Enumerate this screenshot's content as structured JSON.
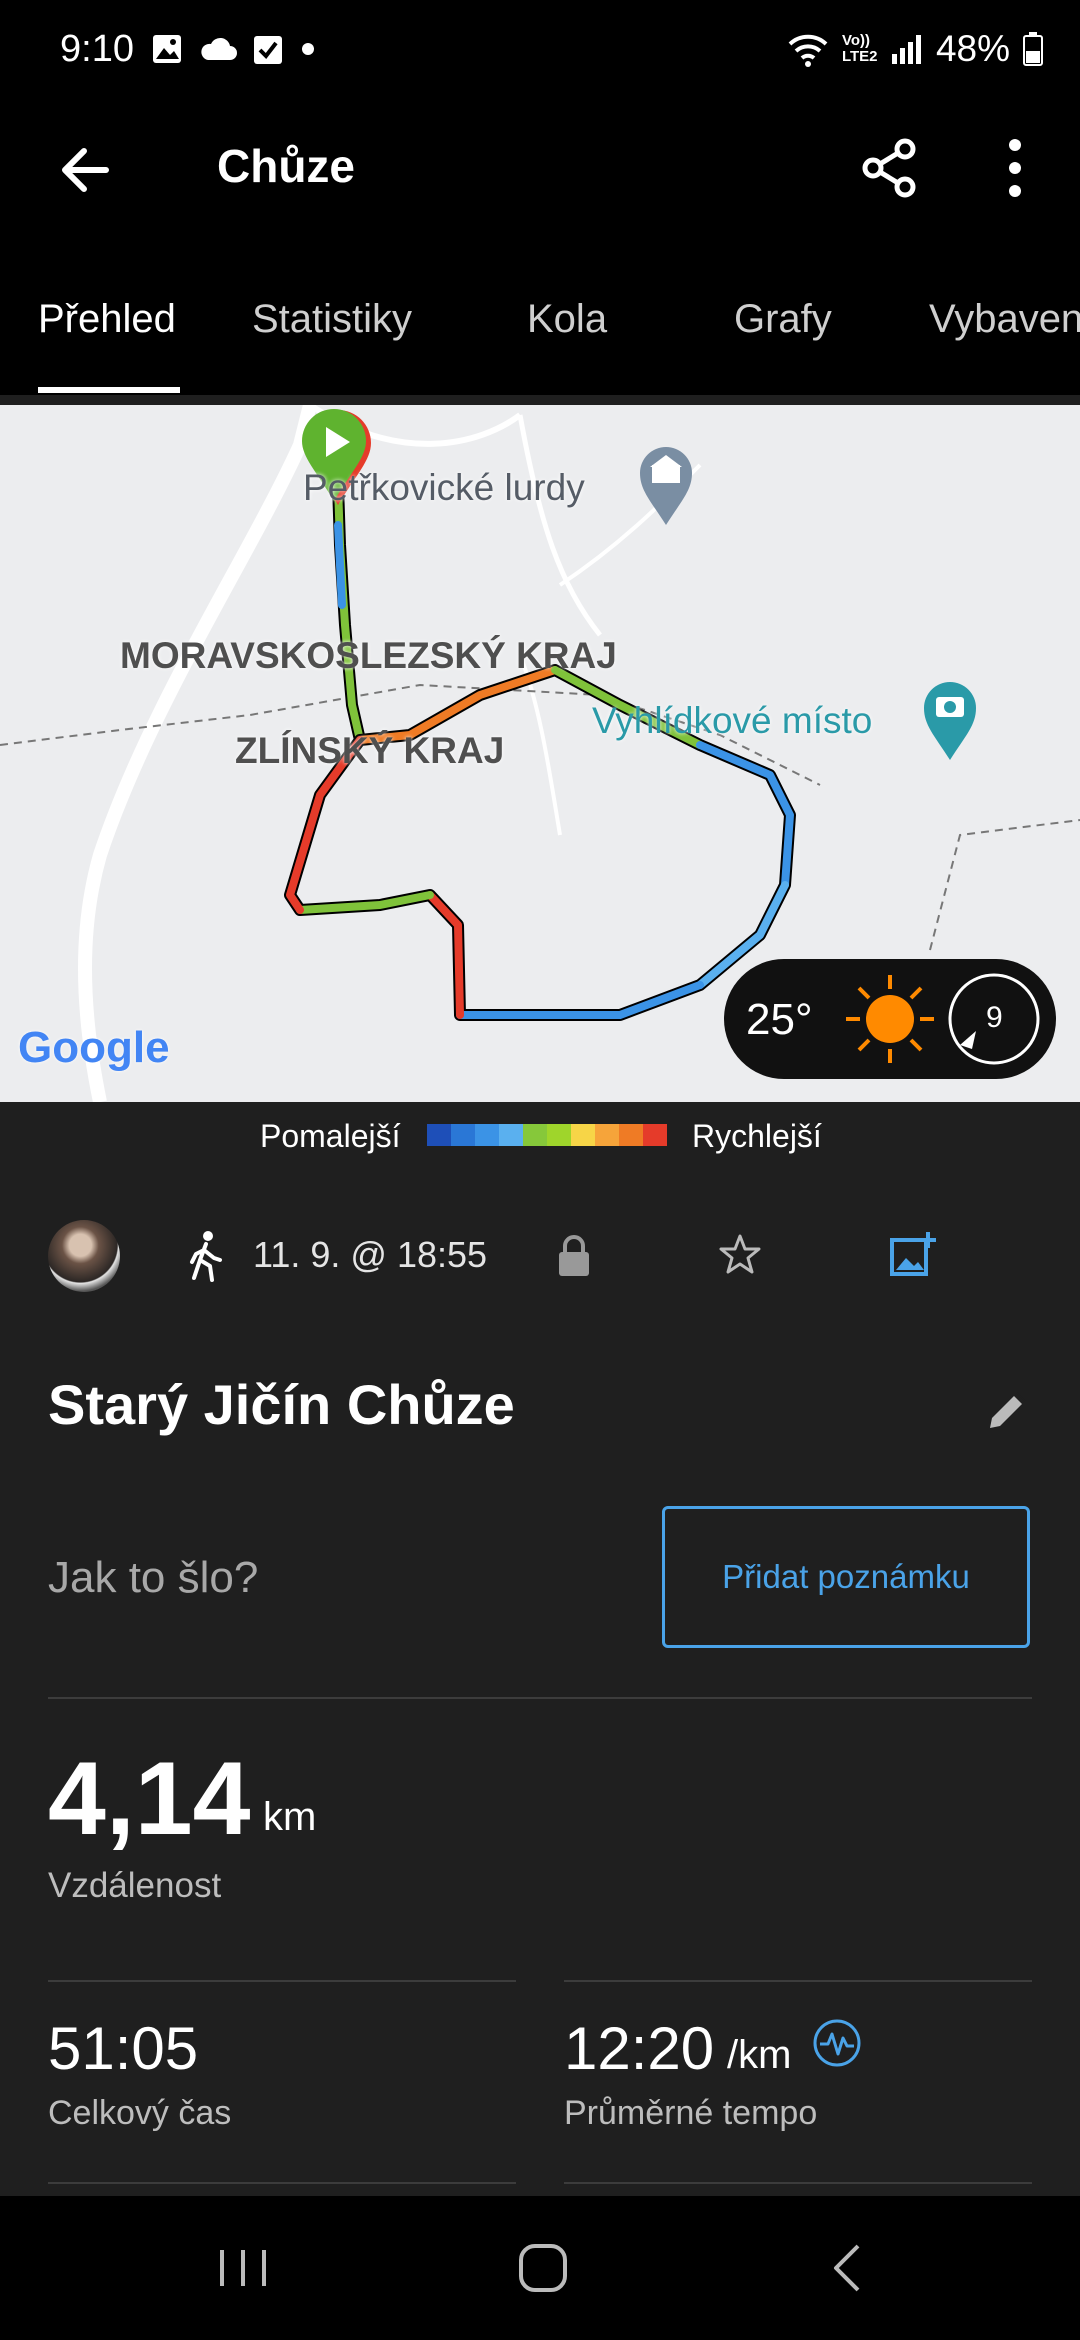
{
  "status_bar": {
    "time": "9:10",
    "battery": "48%",
    "icons": [
      "image-icon",
      "cloud-icon",
      "check-icon",
      "dot-icon",
      "wifi-icon",
      "volte-icon",
      "signal-icon",
      "battery-icon"
    ],
    "volte_label": "Vo)) LTE2"
  },
  "app_bar": {
    "title": "Chůze"
  },
  "tabs": [
    {
      "label": "Přehled",
      "active": true
    },
    {
      "label": "Statistiky",
      "active": false
    },
    {
      "label": "Kola",
      "active": false
    },
    {
      "label": "Grafy",
      "active": false
    },
    {
      "label": "Vybaven",
      "active": false
    }
  ],
  "map": {
    "labels": {
      "place1": "Petřkovické lurdy",
      "region1": "MORAVSKOSLEZSKÝ KRAJ",
      "region2": "ZLÍNSKÝ KRAJ",
      "viewpoint": "Vyhlídkové místo"
    },
    "google_logo": "Google",
    "weather": {
      "temperature": "25°",
      "wind": "9",
      "icon": "sun-icon"
    }
  },
  "pace_legend": {
    "slow_label": "Pomalejší",
    "fast_label": "Rychlejší",
    "colors": [
      "#1e4fb8",
      "#2a77d6",
      "#3b93e6",
      "#5ab0ef",
      "#86c83a",
      "#9fd52b",
      "#f7d547",
      "#f6a43a",
      "#ef7b25",
      "#e53b2a"
    ]
  },
  "activity": {
    "date": "11. 9. @ 18:55",
    "title": "Starý Jičín Chůze",
    "how_was_it": "Jak to šlo?",
    "add_note": "Přidat poznámku",
    "distance_value": "4,14",
    "distance_unit": "km",
    "distance_label": "Vzdálenost",
    "total_time_value": "51:05",
    "total_time_label": "Celkový čas",
    "avg_pace_value": "12:20",
    "avg_pace_unit": "/km",
    "avg_pace_label": "Průměrné tempo"
  },
  "colors": {
    "accent": "#4aa3e8",
    "background": "#1f1f1f",
    "start_marker": "#5fb32f"
  }
}
